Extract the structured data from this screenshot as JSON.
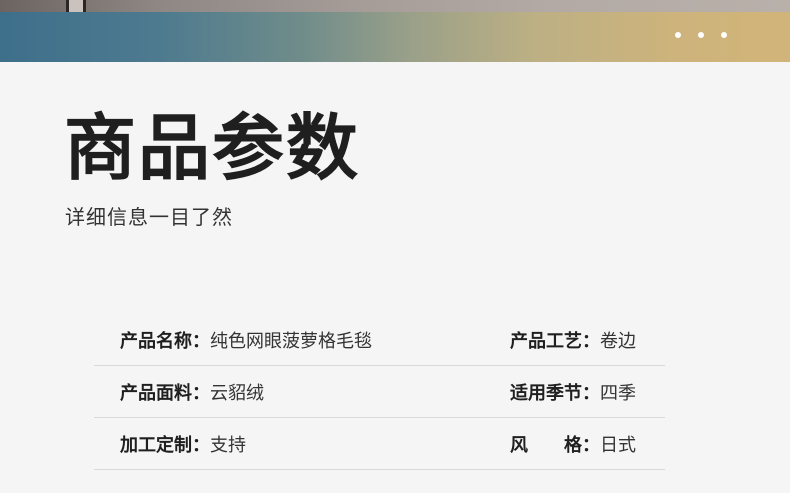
{
  "header": {
    "dots": 3
  },
  "section": {
    "title": "商品参数",
    "subtitle": "详细信息一目了然"
  },
  "params": [
    {
      "left_label": "产品名称：",
      "left_value": "纯色网眼菠萝格毛毯",
      "right_label": "产品工艺：",
      "right_value": "卷边"
    },
    {
      "left_label": "产品面料：",
      "left_value": "云貂绒",
      "right_label": "适用季节：",
      "right_value": "四季"
    },
    {
      "left_label": "加工定制：",
      "left_value": "支持",
      "right_label": "风　　格：",
      "right_value": "日式"
    }
  ],
  "colors": {
    "banner_start": "#3e6f8b",
    "banner_end": "#d1b479",
    "background": "#f5f5f5",
    "divider": "#d9d9d9"
  }
}
